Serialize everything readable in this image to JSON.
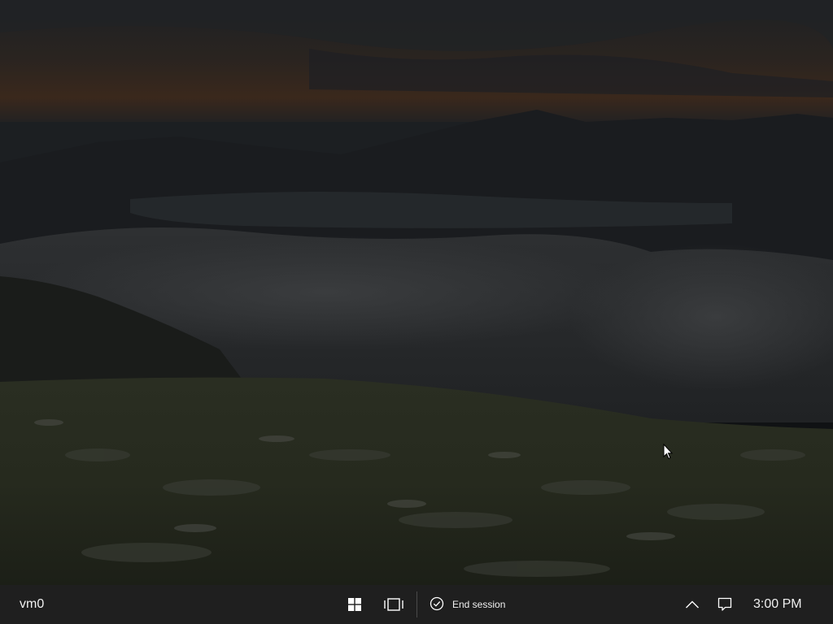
{
  "taskbar": {
    "machine_name": "vm0",
    "end_session_label": "End session",
    "clock": "3:00 PM"
  },
  "icons": {
    "start": "windows-logo-icon",
    "task_view": "task-view-icon",
    "end_session": "checkmark-circle-icon",
    "tray_expand": "chevron-up-icon",
    "notifications": "notification-icon",
    "cursor": "mouse-pointer-icon"
  },
  "colors": {
    "taskbar_bg": "#1f1f1f",
    "taskbar_text": "#f0f0f0"
  }
}
